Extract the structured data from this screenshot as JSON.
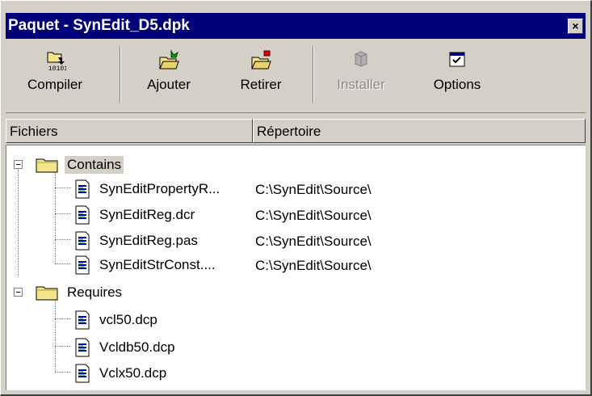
{
  "window": {
    "title": "Paquet - SynEdit_D5.dpk",
    "close_glyph": "×"
  },
  "toolbar": {
    "buttons": [
      {
        "label": "Compiler",
        "icon": "compile-icon",
        "enabled": true
      },
      {
        "label": "Ajouter",
        "icon": "add-folder-icon",
        "enabled": true
      },
      {
        "label": "Retirer",
        "icon": "remove-folder-icon",
        "enabled": true
      },
      {
        "label": "Installer",
        "icon": "install-icon",
        "enabled": false
      },
      {
        "label": "Options",
        "icon": "options-icon",
        "enabled": true
      }
    ]
  },
  "columns": {
    "files": "Fichiers",
    "directory": "Répertoire"
  },
  "tree": {
    "groups": [
      {
        "label": "Contains",
        "icon": "folder-icon",
        "expanded": true,
        "items": [
          {
            "name": "SynEditPropertyR...",
            "path": "C:\\SynEdit\\Source\\",
            "icon": "file-icon"
          },
          {
            "name": "SynEditReg.dcr",
            "path": "C:\\SynEdit\\Source\\",
            "icon": "file-icon"
          },
          {
            "name": "SynEditReg.pas",
            "path": "C:\\SynEdit\\Source\\",
            "icon": "file-icon"
          },
          {
            "name": "SynEditStrConst....",
            "path": "C:\\SynEdit\\Source\\",
            "icon": "file-icon"
          }
        ]
      },
      {
        "label": "Requires",
        "icon": "folder-icon",
        "expanded": true,
        "items": [
          {
            "name": "vcl50.dcp",
            "path": "",
            "icon": "file-icon"
          },
          {
            "name": "Vcldb50.dcp",
            "path": "",
            "icon": "file-icon"
          },
          {
            "name": "Vclx50.dcp",
            "path": "",
            "icon": "file-icon"
          }
        ]
      }
    ]
  },
  "colors": {
    "titlebar": "#00007b",
    "face": "#d4d0c8",
    "folder": "#f4e58a"
  }
}
